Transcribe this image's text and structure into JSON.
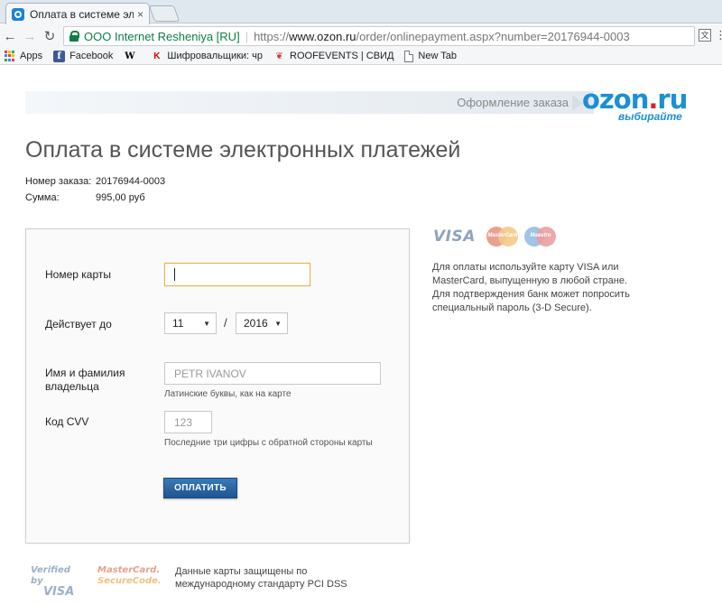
{
  "browser": {
    "tab_title": "Оплата в системе электр",
    "tab_close": "×",
    "back": "←",
    "forward": "→",
    "reload": "↻",
    "secure_label": "OOO Internet Resheniya [RU]",
    "url_scheme": "https://",
    "url_host": "www.ozon.ru",
    "url_rest": "/order/onlinepayment.aspx?number=20176944-0003",
    "translate_icon": "文",
    "menu_icon": "⋮"
  },
  "bookmarks": [
    {
      "label": "Apps",
      "icon": "apps-icon"
    },
    {
      "label": "Facebook",
      "icon": "facebook-icon",
      "glyph": "f"
    },
    {
      "label": "",
      "icon": "wikipedia-icon",
      "glyph": "W"
    },
    {
      "label": "Шифровальщики: чр",
      "icon": "kaspersky-icon",
      "glyph": "K"
    },
    {
      "label": "ROOFEVENTS | СВИД",
      "icon": "roofevents-icon",
      "glyph": "❦"
    },
    {
      "label": "New Tab",
      "icon": "page-icon"
    }
  ],
  "header": {
    "breadcrumb_label": "Оформление заказа",
    "logo_main": "ozon",
    "logo_dot": ".",
    "logo_tld": "ru",
    "logo_tagline": "выбирайте"
  },
  "page": {
    "title": "Оплата в системе электронных платежей",
    "order_label": "Номер заказа:",
    "order_value": "20176944-0003",
    "sum_label": "Сумма:",
    "sum_value": "995,00 руб"
  },
  "form": {
    "card_number_label": "Номер карты",
    "card_number_value": "",
    "valid_until_label": "Действует до",
    "month_value": "11",
    "year_value": "2016",
    "slash": "/",
    "holder_label": "Имя и фамилия владельца",
    "holder_placeholder": "PETR IVANOV",
    "holder_hint": "Латинские буквы, как на карте",
    "cvv_label": "Код CVV",
    "cvv_placeholder": "123",
    "cvv_hint": "Последние три цифры с обратной стороны карты",
    "submit_label": "ОПЛАТИТЬ",
    "dropdown_arrow": "▼"
  },
  "sidebar": {
    "visa_logo": "VISA",
    "mastercard_logo": "MasterCard",
    "maestro_logo": "Maestro",
    "note": "Для оплаты используйте карту VISA или MasterCard, выпущенную в любой стране. Для подтверждения банк может попросить специальный пароль (3-D Secure)."
  },
  "footer": {
    "vbv_line1": "Verified by",
    "vbv_line2": "VISA",
    "msc_line1": "MasterCard.",
    "msc_line2": "SecureCode.",
    "pci_note": "Данные карты защищены по международному стандарту PCI DSS"
  },
  "colors": {
    "ozon_blue": "#1d8fd4",
    "ozon_red": "#e31e24",
    "button_blue": "#2a679f",
    "focus_border": "#e6b44a"
  }
}
